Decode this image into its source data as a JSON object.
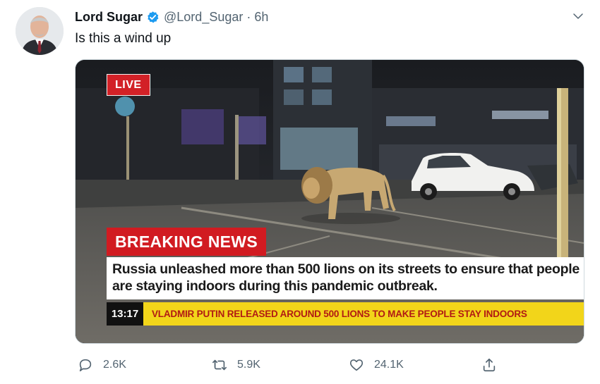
{
  "author": {
    "name": "Lord Sugar",
    "handle": "@Lord_Sugar",
    "separator": "·",
    "time": "6h"
  },
  "tweet": {
    "text": "Is this a wind up"
  },
  "media": {
    "live_label": "LIVE",
    "breaking_label": "BREAKING NEWS",
    "headline": "Russia unleashed more than 500 lions on its streets to ensure that people are staying indoors during this pandemic outbreak.",
    "clock": "13:17",
    "crawl": "VLADMIR PUTIN RELEASED AROUND 500 LIONS TO MAKE PEOPLE STAY INDOORS"
  },
  "actions": {
    "replies": "2.6K",
    "retweets": "5.9K",
    "likes": "24.1K"
  },
  "colors": {
    "verified": "#1d9bf0",
    "breaking_red": "#d11b21",
    "crawl_yellow": "#f2d51a",
    "icon_gray": "#536471"
  }
}
